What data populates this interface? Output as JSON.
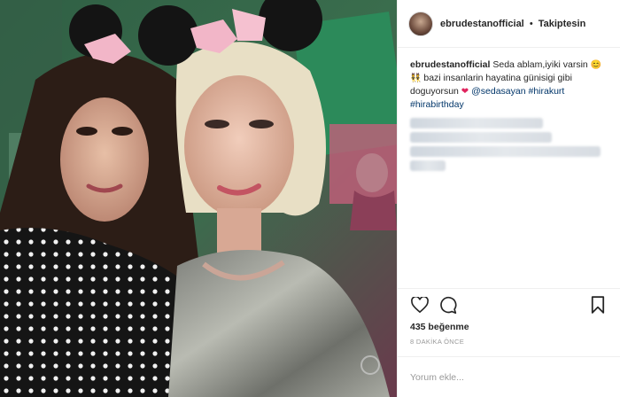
{
  "post": {
    "username": "ebrudestanofficial",
    "separator": "•",
    "follow_status": "Takiptesin",
    "caption": {
      "username": "ebrudestanofficial",
      "text_1": "Seda ablam,iyiki varsin",
      "emoji_1": "😊",
      "text_2": "bazi insanlarin hayatina günisigi gibi doguyorsun",
      "emoji_2": "❤",
      "mention": "@sedasayan",
      "tag_1": "#hirakurt",
      "tag_2": "#hirabirthday"
    },
    "likes": "435 beğenme",
    "time_ago": "8 DAKİKA ÖNCE",
    "comment_placeholder": "Yorum ekle..."
  },
  "icons": {
    "like": "heart-outline-icon",
    "comment": "speech-bubble-icon",
    "save": "bookmark-icon"
  },
  "colors": {
    "text": "#262626",
    "hashtag": "#003569",
    "muted": "#999999",
    "border": "#efefef"
  }
}
